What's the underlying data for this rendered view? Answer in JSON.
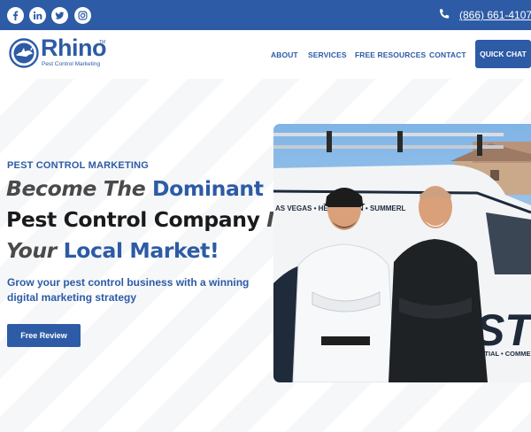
{
  "topbar": {
    "social": [
      {
        "name": "facebook"
      },
      {
        "name": "linkedin"
      },
      {
        "name": "twitter"
      },
      {
        "name": "instagram"
      }
    ],
    "phone": "(866) 661-4107",
    "icons": {
      "facebook": "facebook-icon",
      "linkedin": "linkedin-icon",
      "twitter": "twitter-icon",
      "instagram": "instagram-icon",
      "phone": "phone-icon"
    }
  },
  "header": {
    "logo_word": "Rhino",
    "logo_tm": "TM",
    "logo_sub": "Pest Control Marketing",
    "nav": [
      "ABOUT",
      "SERVICES",
      "FREE RESOURCES",
      "CONTACT"
    ],
    "cta": "QUICK CHAT"
  },
  "hero": {
    "eyebrow": "PEST CONTROL MARKETING",
    "h1": {
      "l1a": "Become The ",
      "l1b": "Dominant",
      "l2a": "Pest Control Company",
      "l2b": " In",
      "l3a": "Your ",
      "l3b": "Local Market!"
    },
    "subtitle": "Grow your pest control business with a winning digital marketing strategy",
    "button": "Free Review",
    "photo": {
      "van_text_top": "AS VEGAS • HENDERSON • SUMMERL",
      "van_text_big": "ST",
      "van_text_bottom": "ENTIAL • COMMER"
    }
  },
  "colors": {
    "brand_blue": "#2d5ba5",
    "heading_dark": "#1a1a1a",
    "heading_gray": "#4a4a4a"
  }
}
